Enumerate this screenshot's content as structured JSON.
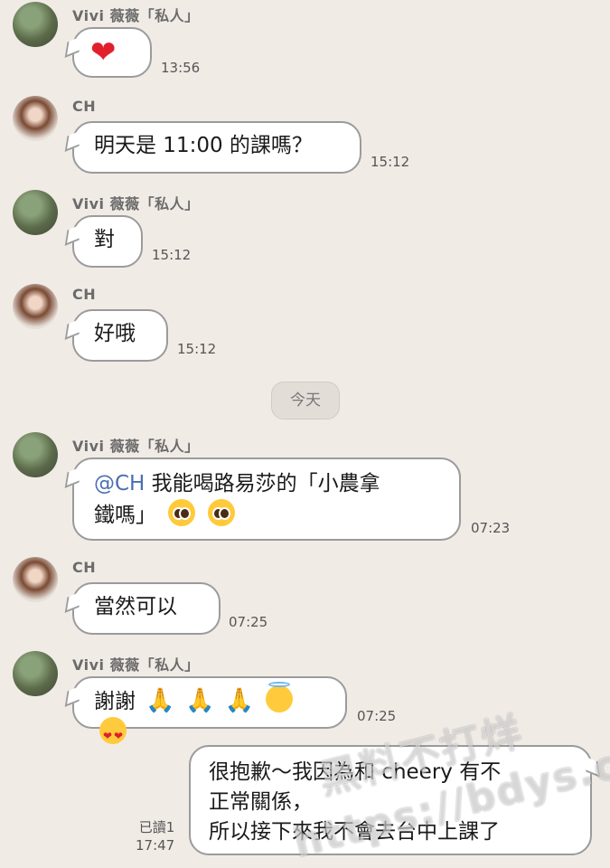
{
  "messages": [
    {
      "sender": "Vivi 薇薇「私人」",
      "text": "❤",
      "time": "13:56"
    },
    {
      "sender": "CH",
      "text": "明天是 11:00 的課嗎？",
      "time": "15:12"
    },
    {
      "sender": "Vivi 薇薇「私人」",
      "text": "對",
      "time": "15:12"
    },
    {
      "sender": "CH",
      "text": "好哦",
      "time": "15:12"
    },
    {
      "sender": "Vivi 薇薇「私人」",
      "mention": "@CH",
      "text": " 我能喝路易莎的「小農拿",
      "text2": "鐵嗎」",
      "time": "07:23"
    },
    {
      "sender": "CH",
      "text": "當然可以",
      "time": "07:25"
    },
    {
      "sender": "Vivi 薇薇「私人」",
      "text": "謝謝",
      "time": "07:25"
    }
  ],
  "day_separator": "今天",
  "outgoing": {
    "line1": "很抱歉～我因為和 cheery 有不",
    "line2": "正常關係，",
    "line3": "所以接下來我不會去台中上課了",
    "read_label": "已讀1",
    "time": "17:47"
  },
  "watermark": {
    "line1": "黑料不打烊",
    "line2": "https://bdys.co"
  },
  "icons": {
    "avatar": "avatar-photo",
    "heart": "red-heart-icon",
    "pleading": "pleading-face-icon",
    "pray": "folded-hands-icon",
    "halo": "halo-face-icon",
    "heart_eyes": "heart-eyes-face-icon"
  }
}
